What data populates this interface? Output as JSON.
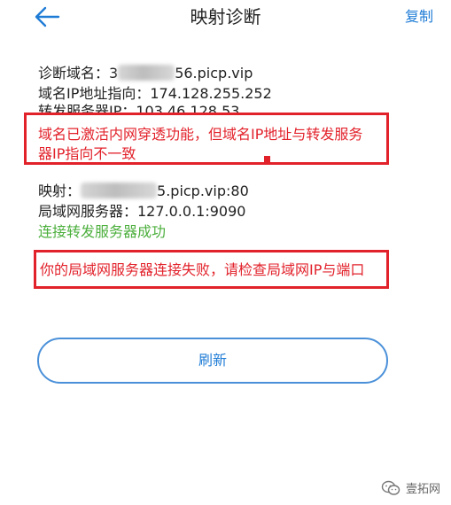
{
  "header": {
    "back_icon": "arrow-left-icon",
    "title": "映射诊断",
    "copy_label": "复制"
  },
  "diagnosis": {
    "domain_prefix": "诊断域名：3",
    "domain_suffix": "56.picp.vip",
    "domain_ip": "域名IP地址指向：174.128.255.252",
    "forward_server": "转发服务器IP：103.46.128.53",
    "warning_line1": "域名已激活内网穿透功能，但域名IP地址与转发服务",
    "warning_line2": "器IP指向不一致"
  },
  "mapping": {
    "mapping_prefix": "映射：",
    "mapping_suffix": "5.picp.vip:80",
    "lan_server": "局域网服务器：127.0.0.1:9090",
    "connect_status": "连接转发服务器成功",
    "error_text": "你的局域网服务器连接失败，请检查局域网IP与端口"
  },
  "actions": {
    "refresh_label": "刷新"
  },
  "watermark": {
    "text": "壹拓网",
    "icon": "wechat-icon"
  },
  "colors": {
    "accent": "#1f7cd6",
    "warning": "#e2222b",
    "success": "#4caf3d",
    "text": "#222222"
  }
}
